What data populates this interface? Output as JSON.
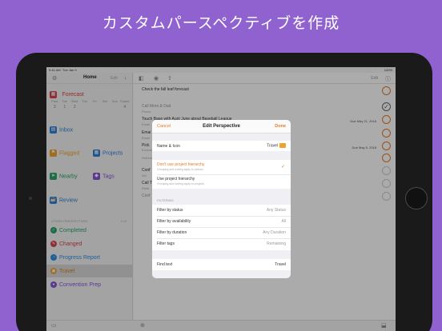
{
  "headline": "カスタムパースペクティブを作成",
  "status": {
    "time": "9:41 AM",
    "date": "Tue Jan 9",
    "battery": "100%"
  },
  "sidebar": {
    "title": "Home",
    "edit": "Edit",
    "forecast": {
      "label": "Forecast",
      "days": [
        "Past",
        "Tue",
        "Wed",
        "Thu",
        "Fri",
        "Sat",
        "Sun",
        "Future"
      ],
      "counts": [
        "3",
        "1",
        "2",
        "",
        "",
        "",
        "",
        "4"
      ]
    },
    "inbox": "Inbox",
    "flagged": "Flagged",
    "projects": "Projects",
    "nearby": "Nearby",
    "tags": "Tags",
    "review": "Review",
    "other_section": "OTHER PERSPECTIVES",
    "other_edit": "Edit",
    "perspectives": [
      {
        "label": "Completed",
        "color": "#2aa56b",
        "icon": "✓"
      },
      {
        "label": "Changed",
        "color": "#d9434a",
        "icon": "✎"
      },
      {
        "label": "Progress Report",
        "color": "#2f8fe0",
        "icon": "◔"
      },
      {
        "label": "Travel",
        "color": "#f0a22c",
        "icon": "▣"
      },
      {
        "label": "Convention Prep",
        "color": "#8a56d8",
        "icon": "●"
      }
    ]
  },
  "main": {
    "edit": "Edit",
    "tasks": [
      {
        "title": "Check the fall leaf forecast",
        "sub": "",
        "due": "",
        "grey": false,
        "circle": "orange"
      },
      {
        "title": "Call Mom & Dad",
        "sub": "Phone",
        "due": "",
        "grey": true,
        "circle": "done"
      },
      {
        "title": "Touch Base with Aunt June about Baseball League",
        "sub": "Email",
        "due": "Due May 21, 2018",
        "grey": false,
        "circle": "orange"
      },
      {
        "title": "Emai",
        "sub": "Email",
        "due": "",
        "grey": false,
        "circle": "orange"
      },
      {
        "title": "Pick",
        "sub": "Errands",
        "due": "",
        "grey": false,
        "circle": "orange"
      },
      {
        "title": "",
        "sub": "Refresh",
        "due": "Due May 5, 2018",
        "grey": true,
        "circle": "orange"
      },
      {
        "title": "Conf",
        "sub": "Sid",
        "due": "",
        "grey": false,
        "circle": "empty"
      },
      {
        "title": "Call T",
        "sub": "Relie",
        "due": "",
        "grey": false,
        "circle": "empty"
      },
      {
        "title": "Conf",
        "sub": "",
        "due": "",
        "grey": true,
        "circle": "empty"
      }
    ]
  },
  "modal": {
    "cancel": "Cancel",
    "title": "Edit Perspective",
    "done": "Done",
    "name_label": "Name & Icon",
    "name_value": "Travel",
    "option1": {
      "label": "Don't use project hierarchy",
      "hint": "Grouping and sorting apply to actions"
    },
    "option2": {
      "label": "Use project hierarchy",
      "hint": "Grouping and sorting apply to projects"
    },
    "filtering_section": "FILTERING",
    "filters": [
      {
        "label": "Filter by status",
        "value": "Any Status"
      },
      {
        "label": "Filter by availability",
        "value": "All"
      },
      {
        "label": "Filter by duration",
        "value": "Any Duration"
      },
      {
        "label": "Filter tags",
        "value": "Remaining"
      }
    ],
    "find_label": "Find text",
    "find_value": "Travel"
  },
  "colors": {
    "background": "#8f62cf",
    "accent": "#e37b2b"
  }
}
